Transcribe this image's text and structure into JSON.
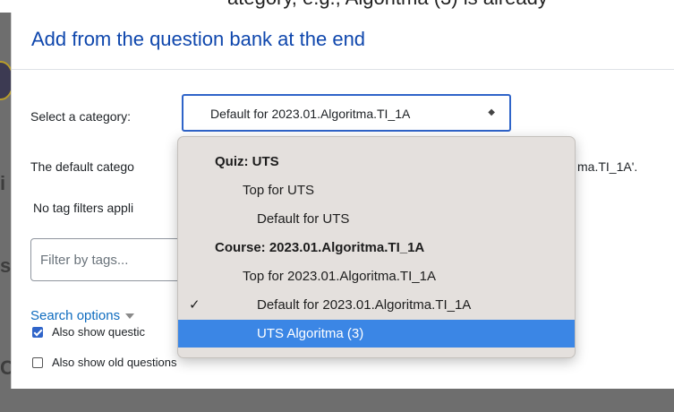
{
  "caption_partial": "ategory, e.g., Algoritma (3) is already",
  "modal": {
    "title": "Add from the question bank at the end",
    "select_category_label": "Select a category:",
    "selected_category": "Default for 2023.01.Algoritma.TI_1A",
    "default_category_prefix": "The default catego",
    "default_category_suffix": "ma.TI_1A'.",
    "no_tag_filters_prefix": "No tag filters appli",
    "filter_placeholder": "Filter by tags...",
    "search_options_label": "Search options",
    "also_show_subcats_label": "Also show questic",
    "also_show_old_label": "Also show old questions"
  },
  "dropdown": {
    "options": [
      {
        "label": "Quiz: UTS",
        "kind": "group"
      },
      {
        "label": "Top for UTS",
        "kind": "option"
      },
      {
        "label": "Default for UTS",
        "kind": "option"
      },
      {
        "label": "Course: 2023.01.Algoritma.TI_1A",
        "kind": "group"
      },
      {
        "label": "Top for 2023.01.Algoritma.TI_1A",
        "kind": "option"
      },
      {
        "label": "Default for 2023.01.Algoritma.TI_1A",
        "kind": "option",
        "checked": true
      },
      {
        "label": "UTS Algoritma (3)",
        "kind": "option",
        "highlighted": true
      }
    ],
    "check_glyph": "✓"
  },
  "checkboxes": {
    "also_show_subcats_checked": true,
    "also_show_old_checked": false
  },
  "colors": {
    "title": "#0f47ad",
    "select_border": "#2f64c9",
    "highlight": "#3b86e5",
    "link": "#0f6cbf",
    "backdrop": "#6e6e6e"
  }
}
